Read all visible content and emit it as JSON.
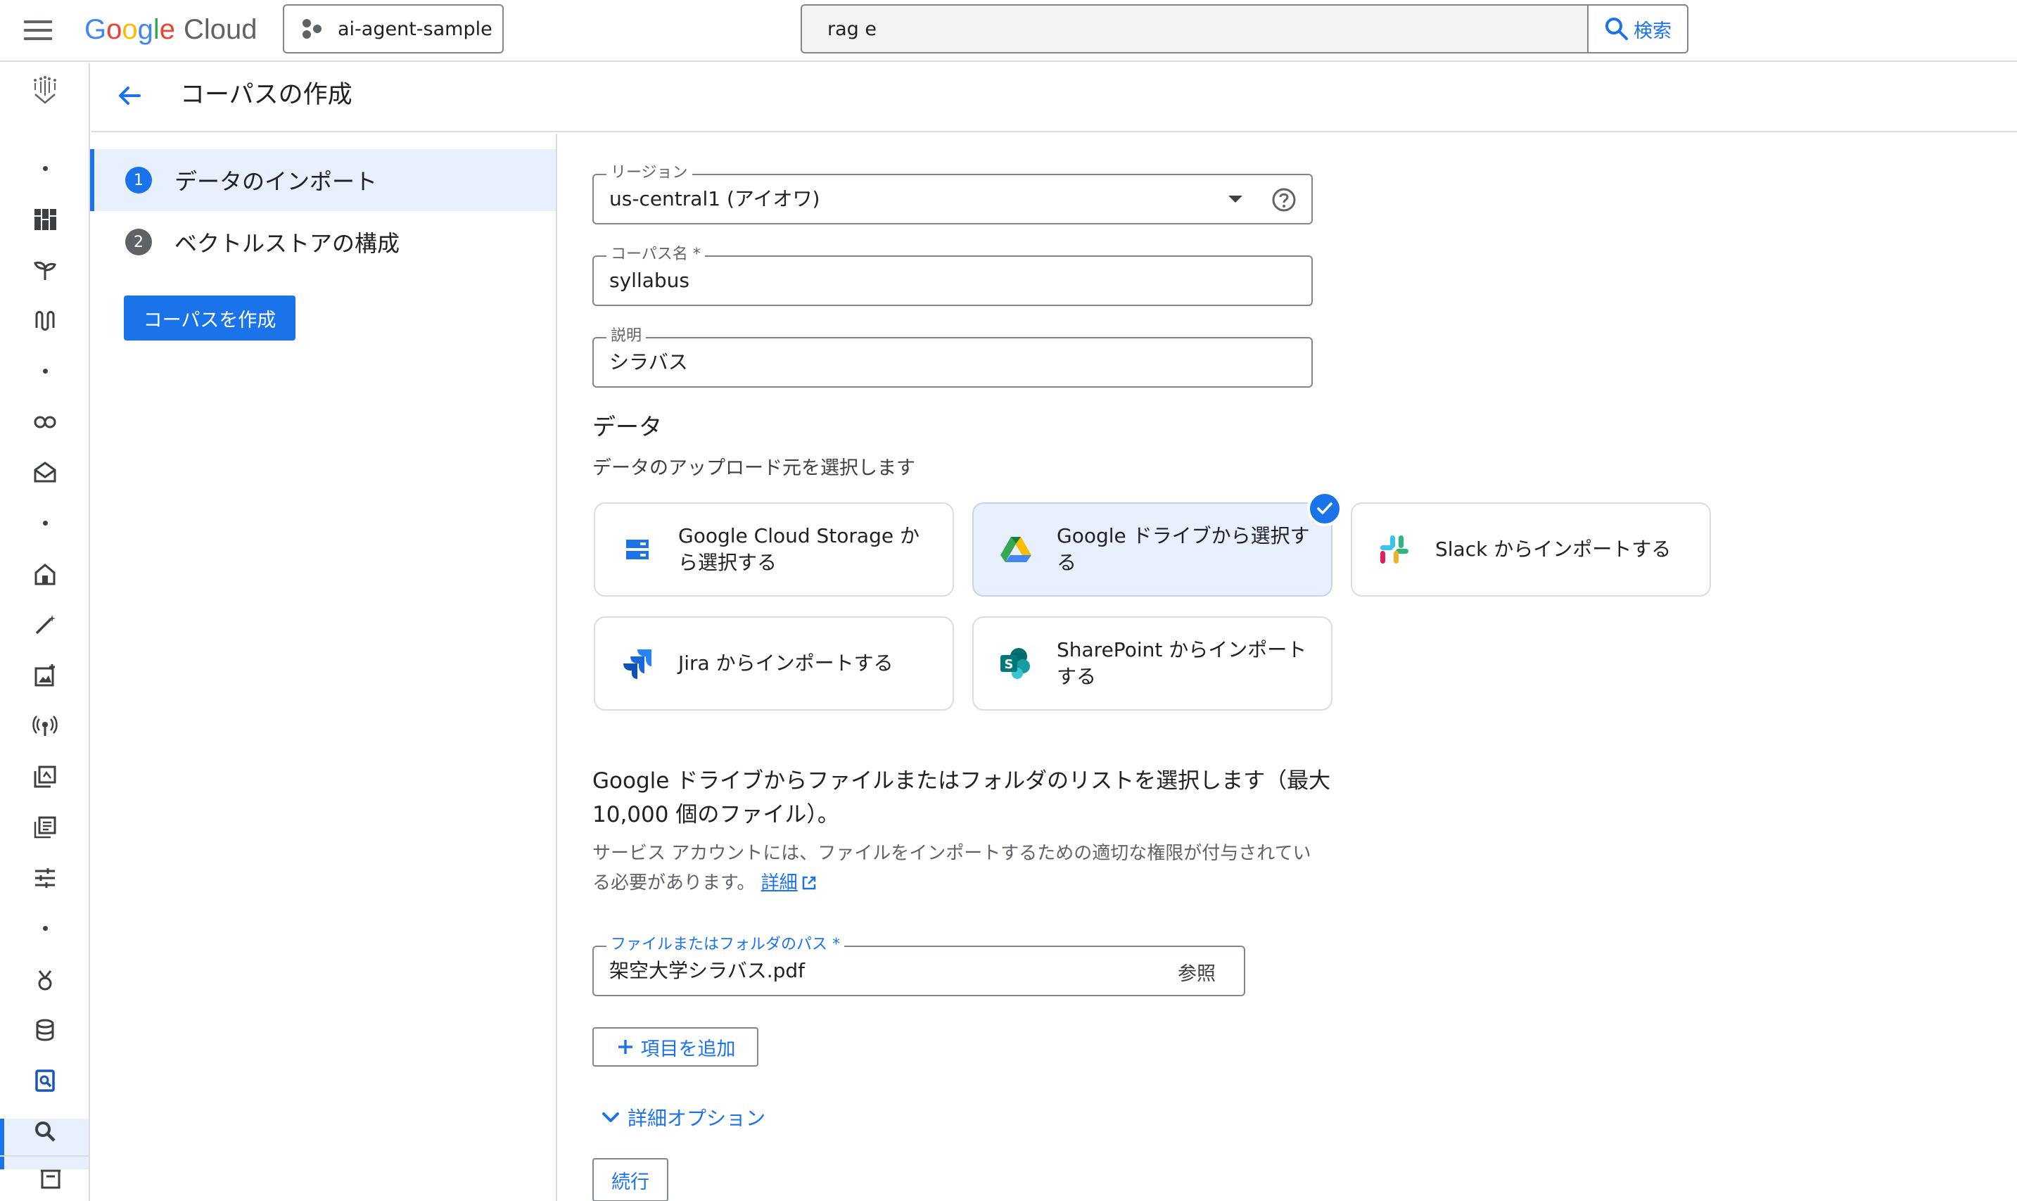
{
  "header": {
    "logo_google": "Google",
    "logo_cloud": "Cloud",
    "project_name": "ai-agent-sample",
    "search_value": "rag e",
    "search_button": "検索"
  },
  "page": {
    "title": "コーパスの作成"
  },
  "stepper": {
    "steps": [
      {
        "num": "1",
        "label": "データのインポート",
        "active": true
      },
      {
        "num": "2",
        "label": "ベクトルストアの構成",
        "active": false
      }
    ],
    "create_button": "コーパスを作成"
  },
  "form": {
    "region_label": "リージョン",
    "region_value": "us-central1 (アイオワ)",
    "corpus_name_label": "コーパス名 *",
    "corpus_name_value": "syllabus",
    "description_label": "説明",
    "description_value": "シラバス"
  },
  "data_section": {
    "heading": "データ",
    "subheading": "データのアップロード元を選択します",
    "sources": [
      {
        "label": "Google Cloud Storage から選択する",
        "icon": "storage-icon",
        "selected": false
      },
      {
        "label": "Google ドライブから選択する",
        "icon": "google-drive-icon",
        "selected": true
      },
      {
        "label": "Slack からインポートする",
        "icon": "slack-icon",
        "selected": false
      },
      {
        "label": "Jira からインポートする",
        "icon": "jira-icon",
        "selected": false
      },
      {
        "label": "SharePoint からインポートする",
        "icon": "sharepoint-icon",
        "selected": false
      }
    ]
  },
  "drive": {
    "info_line": "Google ドライブからファイルまたはフォルダのリストを選択します（最大 10,000 個のファイル）。",
    "permission_note": "サービス アカウントには、ファイルをインポートするための適切な権限が付与されている必要があります。",
    "learn_more": "詳細",
    "path_label": "ファイルまたはフォルダのパス *",
    "path_value": "架空大学シラバス.pdf",
    "browse": "参照",
    "add_item": "項目を追加",
    "advanced_options": "詳細オプション",
    "continue": "続行"
  },
  "colors": {
    "accent": "#1a73e8",
    "selected_bg": "#e8f0fe",
    "border": "#dadce0"
  }
}
